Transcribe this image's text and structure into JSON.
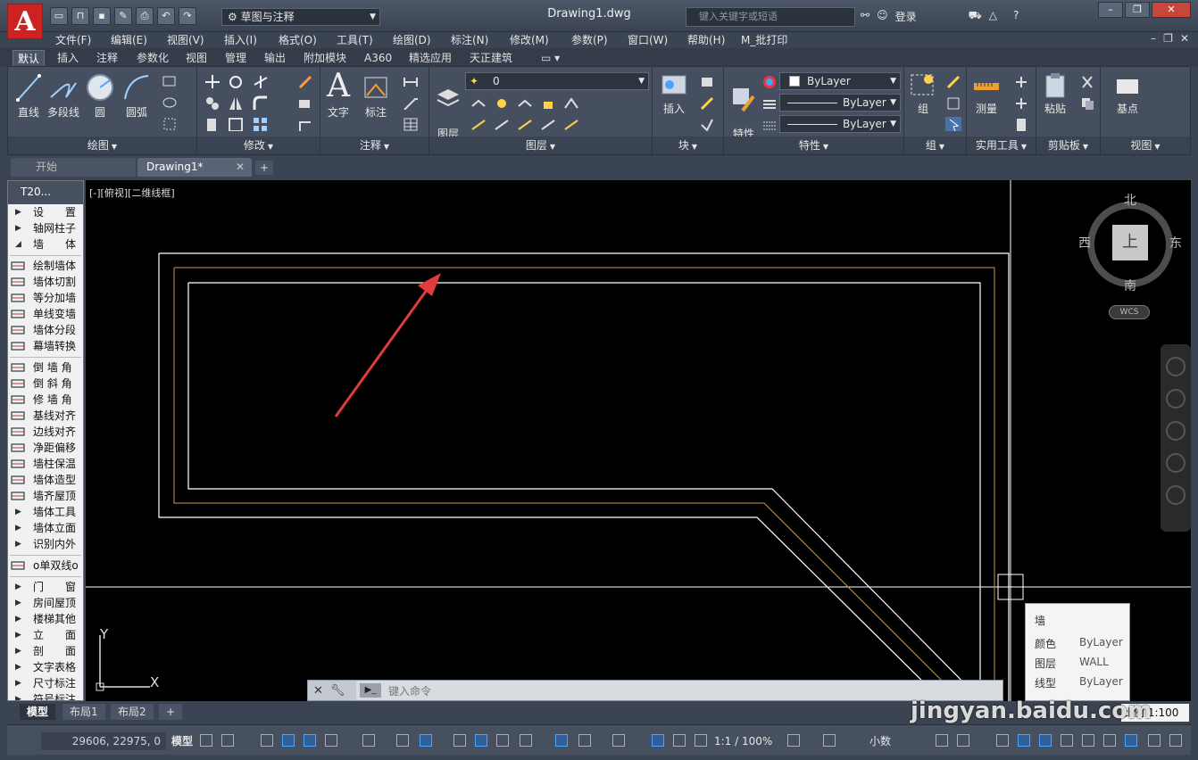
{
  "titlebar": {
    "logo": "A",
    "workspace": "草图与注释",
    "document_title": "Drawing1.dwg",
    "search_placeholder": "键入关键字或短语",
    "login": "登录",
    "help": "?"
  },
  "menu": [
    "文件(F)",
    "编辑(E)",
    "视图(V)",
    "插入(I)",
    "格式(O)",
    "工具(T)",
    "绘图(D)",
    "标注(N)",
    "修改(M)",
    "参数(P)",
    "窗口(W)",
    "帮助(H)",
    "M_批打印"
  ],
  "ribbon_tabs": [
    "默认",
    "插入",
    "注释",
    "参数化",
    "视图",
    "管理",
    "输出",
    "附加模块",
    "A360",
    "精选应用",
    "天正建筑"
  ],
  "ribbon": {
    "draw": {
      "title": "绘图",
      "tools": [
        "直线",
        "多段线",
        "圆",
        "圆弧"
      ]
    },
    "modify": {
      "title": "修改"
    },
    "annotation": {
      "title": "注释",
      "tools": [
        "文字",
        "标注"
      ]
    },
    "layers": {
      "title": "图层",
      "layer_props": "图层\n特性",
      "current_layer": "0"
    },
    "block": {
      "title": "块",
      "insert": "插入"
    },
    "properties": {
      "title": "特性",
      "match": "特性\n匹配",
      "color": "ByLayer",
      "linetype": "ByLayer",
      "lineweight": "ByLayer"
    },
    "group": {
      "title": "组",
      "tool": "组"
    },
    "utilities": {
      "title": "实用工具",
      "measure": "测量"
    },
    "clipboard": {
      "title": "剪贴板",
      "paste": "粘贴"
    },
    "view": {
      "title": "视图",
      "basepoint": "基点"
    }
  },
  "file_tabs": {
    "start": "开始",
    "drawing": "Drawing1*",
    "add": "+"
  },
  "palette": {
    "header": "T20...",
    "items": [
      {
        "label": "设　　置",
        "type": "tri"
      },
      {
        "label": "轴网柱子",
        "type": "tri"
      },
      {
        "label": "墙　　体",
        "type": "open"
      },
      {
        "label": "绘制墙体",
        "type": "icon"
      },
      {
        "label": "墙体切割",
        "type": "icon"
      },
      {
        "label": "等分加墙",
        "type": "icon"
      },
      {
        "label": "单线变墙",
        "type": "icon"
      },
      {
        "label": "墙体分段",
        "type": "icon"
      },
      {
        "label": "幕墙转换",
        "type": "icon"
      },
      {
        "label": "倒 墙 角",
        "type": "icon"
      },
      {
        "label": "倒 斜 角",
        "type": "icon"
      },
      {
        "label": "修 墙 角",
        "type": "icon"
      },
      {
        "label": "基线对齐",
        "type": "icon"
      },
      {
        "label": "边线对齐",
        "type": "icon"
      },
      {
        "label": "净距偏移",
        "type": "icon"
      },
      {
        "label": "墙柱保温",
        "type": "icon"
      },
      {
        "label": "墙体造型",
        "type": "icon"
      },
      {
        "label": "墙齐屋顶",
        "type": "icon"
      },
      {
        "label": "墙体工具",
        "type": "tri"
      },
      {
        "label": "墙体立面",
        "type": "tri"
      },
      {
        "label": "识别内外",
        "type": "tri"
      },
      {
        "label": "o单双线o",
        "type": "icon"
      },
      {
        "label": "门　　窗",
        "type": "tri"
      },
      {
        "label": "房间屋顶",
        "type": "tri"
      },
      {
        "label": "楼梯其他",
        "type": "tri"
      },
      {
        "label": "立　　面",
        "type": "tri"
      },
      {
        "label": "剖　　面",
        "type": "tri"
      },
      {
        "label": "文字表格",
        "type": "tri"
      },
      {
        "label": "尺寸标注",
        "type": "tri"
      },
      {
        "label": "符号标注",
        "type": "tri"
      }
    ]
  },
  "canvas": {
    "view_label": "[-][俯视][二维线框]",
    "viewcube": {
      "north": "北",
      "south": "南",
      "east": "东",
      "west": "西",
      "face": "上",
      "wcs": "WCS"
    },
    "tooltip": {
      "title": "墙",
      "color_label": "颜色",
      "color_value": "ByLayer",
      "layer_label": "图层",
      "layer_value": "WALL",
      "linetype_label": "线型",
      "linetype_value": "ByLayer"
    },
    "ucs": {
      "x": "X",
      "y": "Y"
    },
    "command_placeholder": "键入命令"
  },
  "layout_tabs": [
    "模型",
    "布局1",
    "布局2",
    "+"
  ],
  "status": {
    "coords": "29606, 22975, 0",
    "model": "模型",
    "annotation_scale": "1:1 / 100%",
    "units": "小数",
    "scale_label": "比例 1:100"
  },
  "watermark": "jingyan.baidu.com",
  "colors": {
    "accent": "#e34b3c",
    "wall_outer": "#ffffff",
    "wall_mid": "#c8945a",
    "arrow": "#e23b3b"
  }
}
